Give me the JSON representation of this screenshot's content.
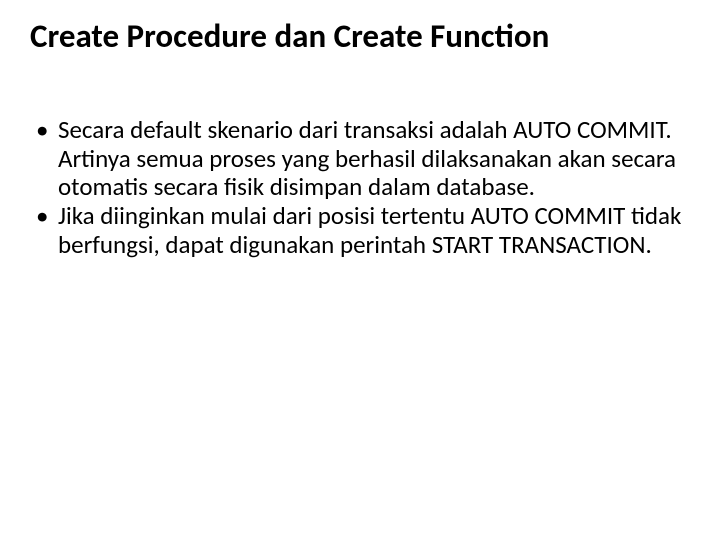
{
  "title": "Create Procedure dan Create Function",
  "bullets": [
    "Secara default skenario dari transaksi adalah AUTO COMMIT. Artinya semua proses yang berhasil dilaksanakan akan secara otomatis secara fisik disimpan dalam database.",
    " Jika diinginkan mulai dari posisi tertentu AUTO COMMIT tidak berfungsi, dapat digunakan perintah START TRANSACTION."
  ]
}
